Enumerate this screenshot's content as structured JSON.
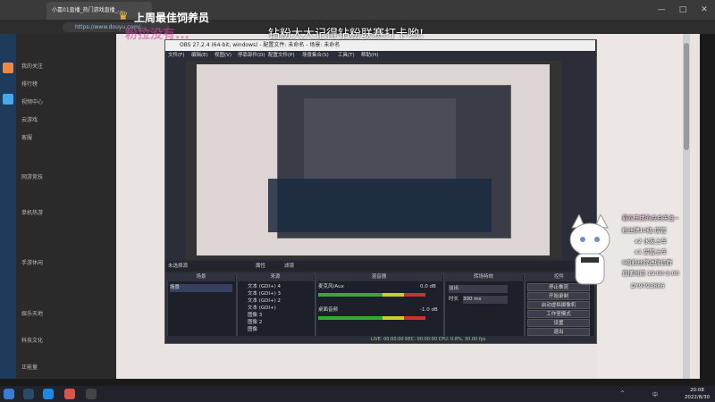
{
  "browser": {
    "tab_title": "小嘉01直播_热门游戏直播_...",
    "url": "https://www.douyu.com/...",
    "window_controls": [
      "—",
      "□",
      "✕"
    ]
  },
  "overlays": {
    "weekly_banner": "上周最佳饲养员",
    "marquee": "钻粉大大记得钻粉联赛打卡哟!",
    "faded_text": "粉拉没有..."
  },
  "left_nav": {
    "items": [
      "我的关注",
      "排行榜",
      "视频中心",
      "云游戏",
      "客服",
      "网游竞技",
      "单机热游",
      "手游休闲",
      "娱乐天地",
      "科技文化",
      "正能量"
    ]
  },
  "obs": {
    "title": "OBS 27.2.4 (64-bit, windows) - 配置文件: 未命名 - 场景: 未命名",
    "menu": [
      "文件(F)",
      "编辑(E)",
      "视图(V)",
      "停靠部件(D)",
      "配置文件(P)",
      "场景集合(S)",
      "工具(T)",
      "帮助(H)"
    ],
    "scene_bar": [
      "未选择源",
      "属性",
      "滤镜"
    ],
    "docks": {
      "scenes": {
        "title": "场景",
        "items": [
          "场景"
        ]
      },
      "sources": {
        "title": "来源",
        "items": [
          "文本 (GDI+) 4",
          "文本 (GDI+) 3",
          "文本 (GDI+) 2",
          "文本 (GDI+)",
          "图像 3",
          "图像 2",
          "图像"
        ]
      },
      "mixer": {
        "title": "混音器",
        "channels": [
          {
            "name": "麦克风/Aux",
            "db": "0.0 dB"
          },
          {
            "name": "桌面音频",
            "db": "-1.0 dB"
          }
        ]
      },
      "transitions": {
        "title": "转场特效",
        "type": "淡出",
        "duration_label": "时长",
        "duration": "300 ms"
      },
      "controls": {
        "title": "控件",
        "buttons": [
          "停止推流",
          "开始录制",
          "启动虚拟摄像机",
          "工作室模式",
          "设置",
          "退出"
        ]
      }
    },
    "status": "LIVE: 00:00:00  REC: 00:00:00  CPU: 0.8%, 30.00 fps"
  },
  "promo": {
    "lines": [
      "最欢王播的点点关注~",
      "粉丝牌10级-房管",
      "x2 水友上车",
      "x1 房管上车",
      "8级粉丝牌进微信群",
      "直播时间 19:00-5:00",
      "DY9793886"
    ]
  },
  "taskbar": {
    "time": "20:08",
    "date": "2022/8/30",
    "tray": [
      "^",
      "中"
    ]
  },
  "colors": {
    "obs_bg": "#2b2e38",
    "page_bg": "#e9e4e2",
    "accent_purple": "#7b52d6",
    "taskbar": "#20232a"
  }
}
